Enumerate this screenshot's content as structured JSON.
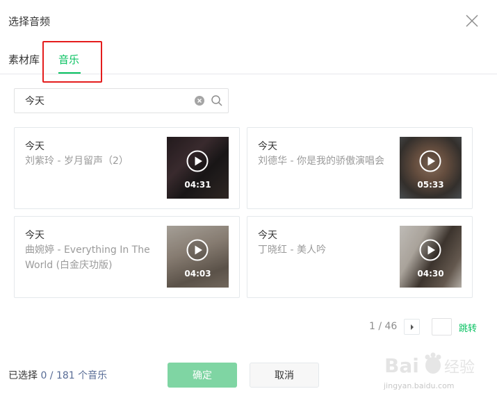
{
  "dialog": {
    "title": "选择音频"
  },
  "tabs": [
    {
      "label": "素材库",
      "active": false
    },
    {
      "label": "音乐",
      "active": true
    }
  ],
  "search": {
    "value": "今天",
    "placeholder": ""
  },
  "items": [
    {
      "name": "今天",
      "artist_line": "刘紫玲 - 岁月留声（2）",
      "duration": "04:31"
    },
    {
      "name": "今天",
      "artist_line": "刘德华 - 你是我的骄傲演唱会",
      "duration": "05:33"
    },
    {
      "name": "今天",
      "artist_line": "曲婉婷 - Everything In The World (白金庆功版)",
      "duration": "04:03"
    },
    {
      "name": "今天",
      "artist_line": "丁晓红 - 美人吟",
      "duration": "04:30"
    }
  ],
  "pagination": {
    "text": "1 / 46",
    "jump_label": "跳转",
    "page_input_value": ""
  },
  "footer": {
    "selected_prefix": "已选择",
    "selected_count": "0 / 181",
    "selected_suffix": "个音乐",
    "confirm_label": "确定",
    "cancel_label": "取消"
  },
  "watermark": {
    "logo_text": "Bai 经验",
    "url": "jingyan.baidu.com"
  },
  "colors": {
    "accent": "#07c160",
    "highlight": "#e41c1c",
    "confirm_disabled": "#7fd5a3",
    "link": "#576b95"
  },
  "icons": [
    "close-icon",
    "clear-icon",
    "search-icon",
    "play-icon",
    "chevron-right-icon"
  ]
}
